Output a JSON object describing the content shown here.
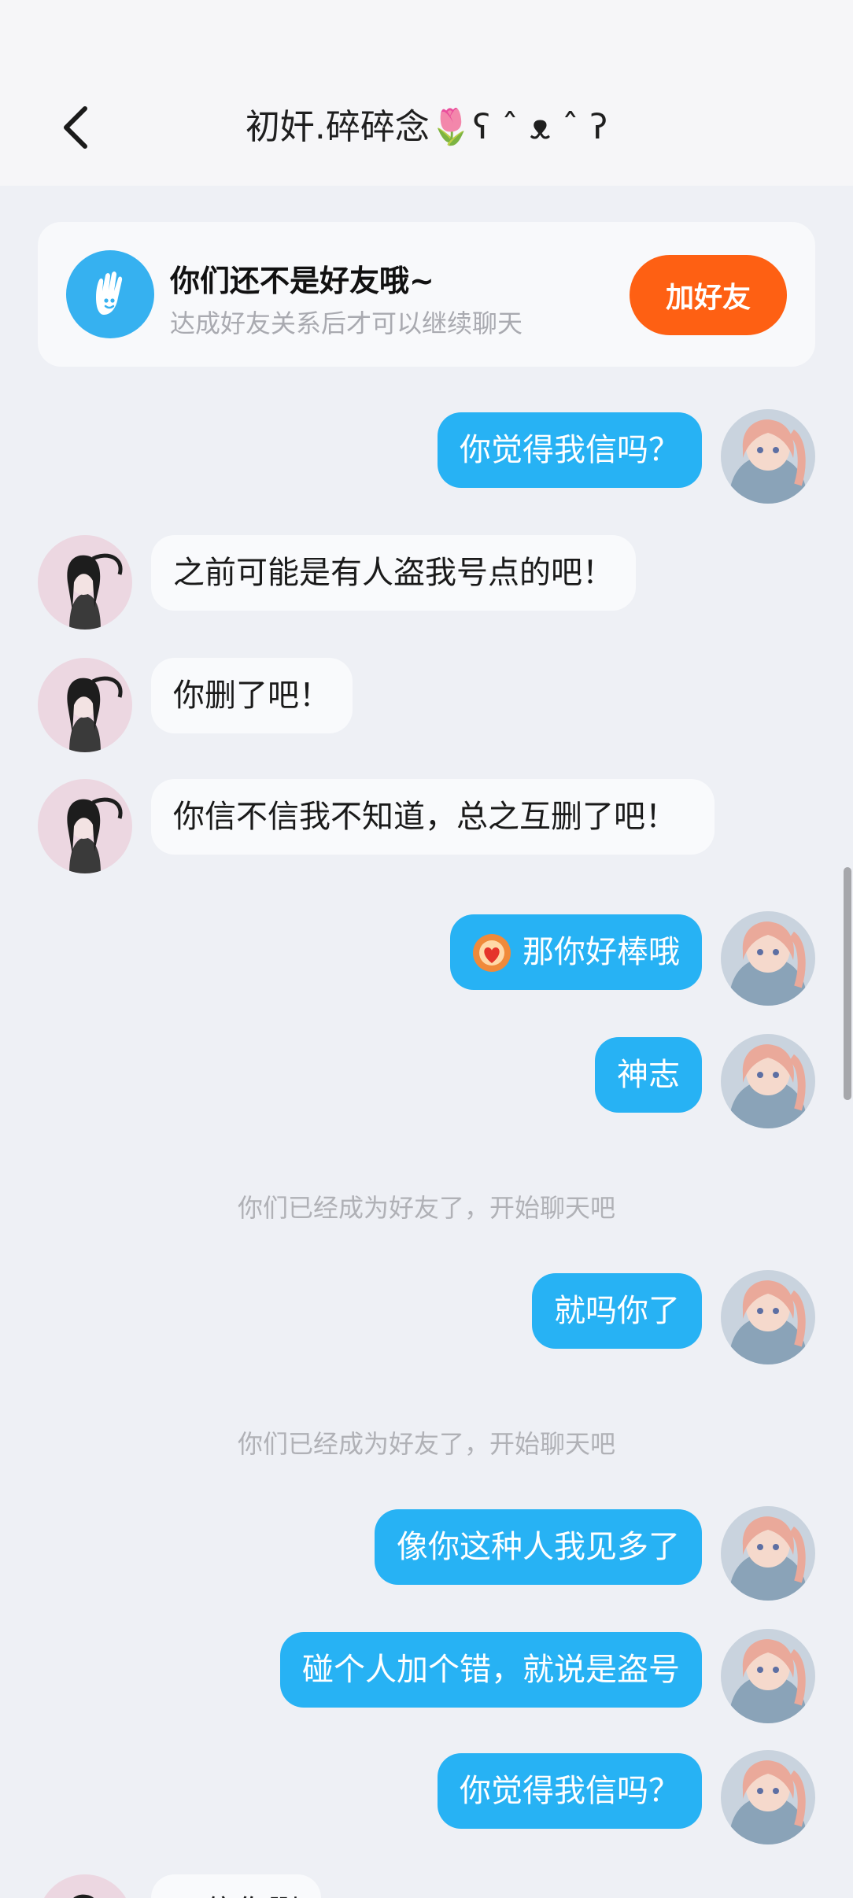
{
  "header": {
    "title": "初奸.碎碎念🌷ʕ ˆ ᴥ ˆ ʔ",
    "back_icon": "chevron-left-icon"
  },
  "friend_card": {
    "icon": "waving-hand-icon",
    "title": "你们还不是好友哦~",
    "subtitle": "达成好友关系后才可以继续聊天",
    "add_button": "加好友",
    "accent_color": "#fe6013"
  },
  "messages": [
    {
      "side": "out",
      "text": "你觉得我信吗？"
    },
    {
      "side": "in",
      "text": "之前可能是有人盗我号点的吧！"
    },
    {
      "side": "in",
      "text": "你删了吧！"
    },
    {
      "side": "in",
      "text": "你信不信我不知道，总之互删了吧！"
    },
    {
      "side": "out",
      "text": "那你好棒哦",
      "sticker": "lion-heart-icon"
    },
    {
      "side": "out",
      "text": "神志"
    },
    {
      "side": "system",
      "text": "你们已经成为好友了，开始聊天吧"
    },
    {
      "side": "out",
      "text": "就吗你了"
    },
    {
      "side": "system",
      "text": "你们已经成为好友了，开始聊天吧"
    },
    {
      "side": "out",
      "text": "像你这种人我见多了"
    },
    {
      "side": "out",
      "text": "碰个人加个错，就说是盗号"
    },
    {
      "side": "out",
      "text": "你觉得我信吗？"
    },
    {
      "side": "in",
      "text": "不信你删"
    }
  ],
  "colors": {
    "outgoing_bubble": "#27b2f4",
    "incoming_bubble": "#f9fafc",
    "background": "#eef0f5"
  }
}
